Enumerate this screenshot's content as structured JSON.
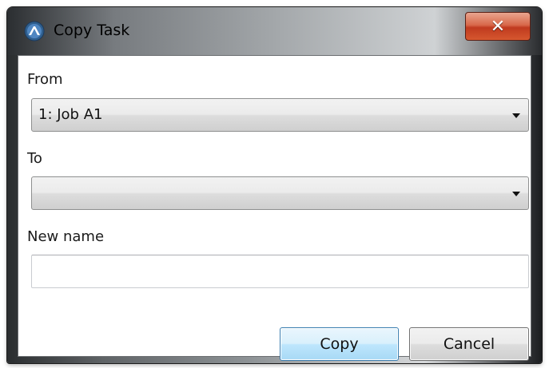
{
  "window": {
    "title": "Copy Task",
    "close_glyph": "✕",
    "icon": "app-logo-icon"
  },
  "form": {
    "from_label": "From",
    "from_value": "1: Job A1",
    "to_label": "To",
    "to_value": "",
    "new_name_label": "New name",
    "new_name_value": "",
    "new_name_placeholder": ""
  },
  "buttons": {
    "copy_label": "Copy",
    "cancel_label": "Cancel"
  },
  "colors": {
    "close_button": "#c8452a",
    "default_button_border": "#3c7fb1"
  }
}
